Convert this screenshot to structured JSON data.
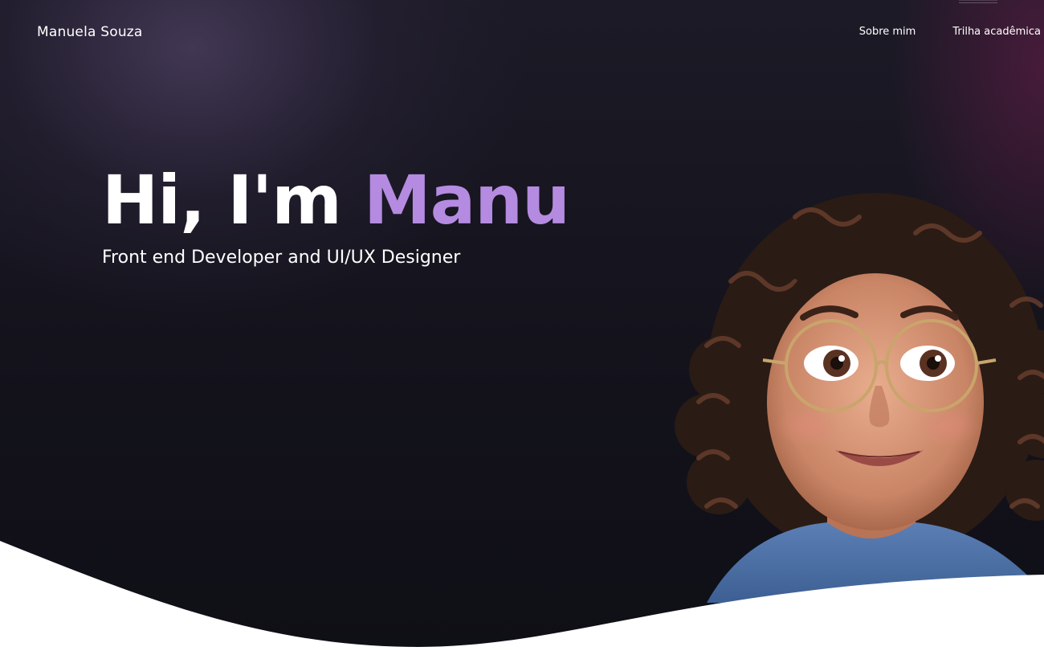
{
  "nav": {
    "brand": "Manuela Souza",
    "links": [
      "Sobre mim",
      "Trilha acadêmica"
    ]
  },
  "hero": {
    "greeting": "Hi, I'm ",
    "name": "Manu",
    "subtitle": "Front end Developer and UI/UX Designer"
  },
  "colors": {
    "accent": "#b48be0",
    "background": "#12111a",
    "wave": "#ffffff"
  },
  "avatar": {
    "icon": "avatar-illustration"
  }
}
